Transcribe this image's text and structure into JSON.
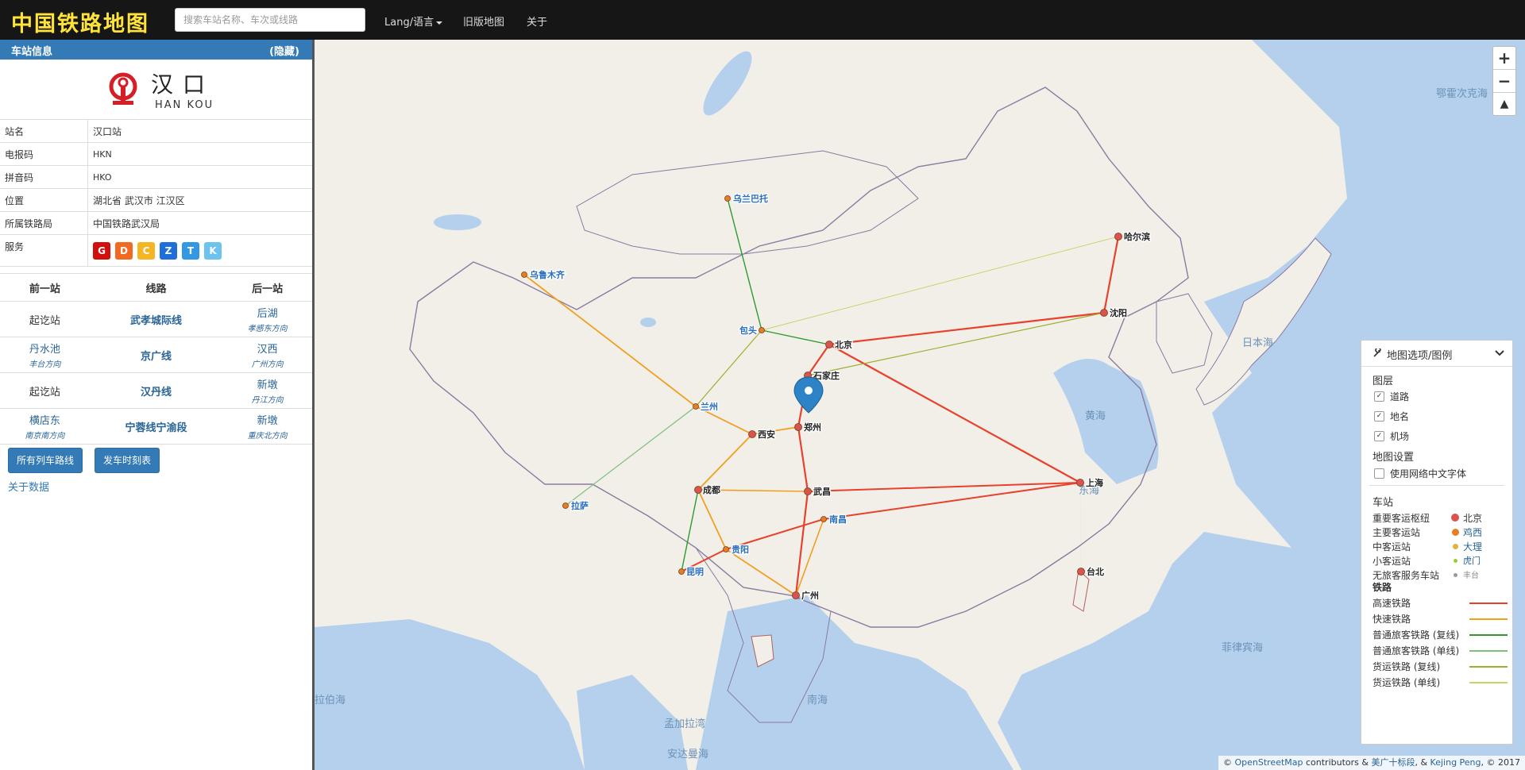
{
  "header": {
    "brand": "中国铁路地图",
    "search_placeholder": "搜索车站名称、车次或线路",
    "nav": {
      "lang": "Lang/语言",
      "old_map": "旧版地图",
      "about": "关于"
    }
  },
  "sidebar": {
    "panel_title": "车站信息",
    "hide_label": "(隐藏)",
    "station": {
      "name_cn": "汉口",
      "name_en": "HAN KOU"
    },
    "info": [
      {
        "key": "站名",
        "value": "汉口站"
      },
      {
        "key": "电报码",
        "value": "HKN"
      },
      {
        "key": "拼音码",
        "value": "HKO"
      },
      {
        "key": "位置",
        "value": "湖北省 武汉市 江汉区"
      },
      {
        "key": "所属铁路局",
        "value": "中国铁路武汉局"
      },
      {
        "key": "服务",
        "value": ""
      }
    ],
    "services": [
      {
        "letter": "G",
        "color": "#d10f0f"
      },
      {
        "letter": "D",
        "color": "#f26a21"
      },
      {
        "letter": "C",
        "color": "#f5b623"
      },
      {
        "letter": "Z",
        "color": "#1e6fd9"
      },
      {
        "letter": "T",
        "color": "#3398e4"
      },
      {
        "letter": "K",
        "color": "#6cc3ef"
      }
    ],
    "neighbors": {
      "headers": {
        "prev": "前一站",
        "line": "线路",
        "next": "后一站"
      },
      "rows": [
        {
          "prev": "起讫站",
          "prev_dir": "",
          "line": "武孝城际线",
          "next": "后湖",
          "next_dir": "孝感东方向"
        },
        {
          "prev": "丹水池",
          "prev_dir": "丰台方向",
          "line": "京广线",
          "next": "汉西",
          "next_dir": "广州方向"
        },
        {
          "prev": "起讫站",
          "prev_dir": "",
          "line": "汉丹线",
          "next": "新墩",
          "next_dir": "丹江方向"
        },
        {
          "prev": "横店东",
          "prev_dir": "南京南方向",
          "line": "宁蓉线宁渝段",
          "next": "新墩",
          "next_dir": "重庆北方向"
        }
      ]
    },
    "buttons": {
      "all_trains": "所有列车路线",
      "timetable": "发车时刻表"
    },
    "about_data": "关于数据"
  },
  "map": {
    "cities": [
      {
        "name": "北京",
        "type": "major"
      },
      {
        "name": "哈尔滨",
        "type": "major"
      },
      {
        "name": "沈阳",
        "type": "major"
      },
      {
        "name": "石家庄",
        "type": "major"
      },
      {
        "name": "郑州",
        "type": "major"
      },
      {
        "name": "西安",
        "type": "major"
      },
      {
        "name": "武昌",
        "type": "major"
      },
      {
        "name": "上海",
        "type": "major"
      },
      {
        "name": "成都",
        "type": "major"
      },
      {
        "name": "广州",
        "type": "major"
      },
      {
        "name": "台北",
        "type": "major"
      },
      {
        "name": "南昌",
        "type": "main"
      },
      {
        "name": "贵阳",
        "type": "main"
      },
      {
        "name": "昆明",
        "type": "main"
      },
      {
        "name": "兰州",
        "type": "main"
      },
      {
        "name": "包头",
        "type": "main"
      },
      {
        "name": "乌鲁木齐",
        "type": "main"
      },
      {
        "name": "乌兰巴托",
        "type": "main"
      },
      {
        "name": "拉萨",
        "type": "main"
      }
    ],
    "seas": [
      "鄂霍次克海",
      "日本海",
      "黄海",
      "东海",
      "菲律宾海",
      "南海",
      "孟加拉湾",
      "安达曼海",
      "拉伯海"
    ],
    "zoom": {
      "in": "+",
      "out": "−",
      "compass": "▲"
    },
    "attribution": {
      "prefix": "©",
      "osm": "OpenStreetMap",
      "mid": " contributors & ",
      "author1": "美广十标段",
      "amp": ", & ",
      "author2": "Kejing Peng",
      "year": ", © 2017"
    }
  },
  "legend": {
    "title": "地图选项/图例",
    "layers_title": "图层",
    "layers": [
      "道路",
      "地名",
      "机场"
    ],
    "settings_title": "地图设置",
    "setting_font": "使用网络中文字体",
    "stations_title": "车站",
    "stations": [
      {
        "label": "重要客运枢纽",
        "example": "北京",
        "color": "#d9534f"
      },
      {
        "label": "主要客运站",
        "example": "鸡西",
        "color": "#e67e22"
      },
      {
        "label": "中客运站",
        "example": "大理",
        "color": "#e3b341"
      },
      {
        "label": "小客运站",
        "example": "虎门",
        "color": "#9acd32"
      },
      {
        "label": "无旅客服务车站",
        "example": "丰台",
        "color": "#999999"
      }
    ],
    "rail_title": "铁路",
    "rails": [
      {
        "label": "高速铁路",
        "color": "#e8412c"
      },
      {
        "label": "快速铁路",
        "color": "#f0a020"
      },
      {
        "label": "普通旅客铁路 (复线)",
        "color": "#2e9a2e"
      },
      {
        "label": "普通旅客铁路 (单线)",
        "color": "#7cc07c"
      },
      {
        "label": "货运铁路 (复线)",
        "color": "#9ab12f"
      },
      {
        "label": "货运铁路 (单线)",
        "color": "#c8d36a"
      }
    ]
  }
}
